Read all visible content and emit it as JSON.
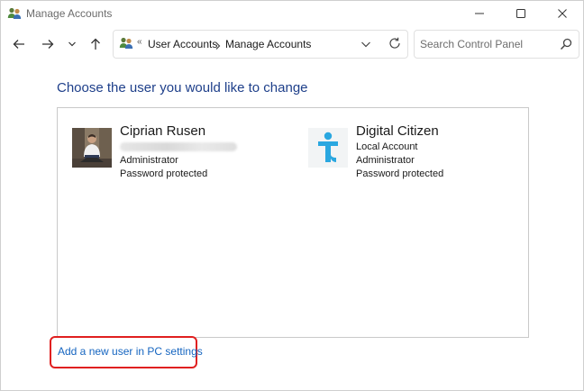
{
  "window": {
    "title": "Manage Accounts",
    "title_icon": "users-icon"
  },
  "nav": {
    "back_icon": "arrow-left-icon",
    "forward_icon": "arrow-right-icon",
    "recent_icon": "chevron-down-icon",
    "up_icon": "arrow-up-icon"
  },
  "address": {
    "overflow": "«",
    "crumbs": [
      "User Accounts",
      "Manage Accounts"
    ],
    "separator_icon": "chevron-right-icon",
    "dropdown_icon": "chevron-down-icon",
    "refresh_icon": "refresh-icon"
  },
  "search": {
    "placeholder": "Search Control Panel",
    "value": ""
  },
  "main": {
    "heading": "Choose the user you would like to change",
    "users": [
      {
        "name": "Ciprian Rusen",
        "lines": [
          "Administrator",
          "Password protected"
        ]
      },
      {
        "name": "Digital Citizen",
        "lines": [
          "Local Account",
          "Administrator",
          "Password protected"
        ]
      }
    ],
    "add_user_link": "Add a new user in PC settings"
  },
  "colors": {
    "heading": "#1e3f8a",
    "link": "#1565c0",
    "highlight": "#e02020",
    "dc_logo": "#2aa7e0"
  }
}
